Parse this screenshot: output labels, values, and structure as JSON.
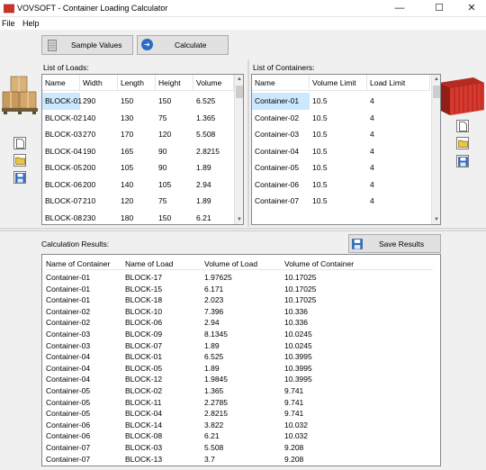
{
  "window": {
    "title": "VOVSOFT - Container Loading Calculator",
    "minimize_glyph": "—",
    "maximize_glyph": "☐",
    "close_glyph": "✕"
  },
  "menu": [
    "File",
    "Help"
  ],
  "toolbar": {
    "sample_values_label": "Sample Values",
    "calculate_label": "Calculate",
    "calculate_glyph": "➜"
  },
  "loads": {
    "label": "List of Loads:",
    "columns": [
      "Name",
      "Width",
      "Length",
      "Height",
      "Volume"
    ],
    "rows": [
      [
        "BLOCK-01",
        "290",
        "150",
        "150",
        "6.525"
      ],
      [
        "BLOCK-02",
        "140",
        "130",
        "75",
        "1.365"
      ],
      [
        "BLOCK-03",
        "270",
        "170",
        "120",
        "5.508"
      ],
      [
        "BLOCK-04",
        "190",
        "165",
        "90",
        "2.8215"
      ],
      [
        "BLOCK-05",
        "200",
        "105",
        "90",
        "1.89"
      ],
      [
        "BLOCK-06",
        "200",
        "140",
        "105",
        "2.94"
      ],
      [
        "BLOCK-07",
        "210",
        "120",
        "75",
        "1.89"
      ],
      [
        "BLOCK-08",
        "230",
        "180",
        "150",
        "6.21"
      ]
    ],
    "selected_row": 0
  },
  "containers": {
    "label": "List of Containers:",
    "columns": [
      "Name",
      "Volume Limit",
      "Load Limit"
    ],
    "rows": [
      [
        "Container-01",
        "10.5",
        "4"
      ],
      [
        "Container-02",
        "10.5",
        "4"
      ],
      [
        "Container-03",
        "10.5",
        "4"
      ],
      [
        "Container-04",
        "10.5",
        "4"
      ],
      [
        "Container-05",
        "10.5",
        "4"
      ],
      [
        "Container-06",
        "10.5",
        "4"
      ],
      [
        "Container-07",
        "10.5",
        "4"
      ]
    ],
    "selected_row": 0
  },
  "results": {
    "label": "Calculation Results:",
    "save_label": "Save Results",
    "columns": [
      "Name of Container",
      "Name of Load",
      "Volume of Load",
      "Volume of Container"
    ],
    "rows": [
      [
        "Container-01",
        "BLOCK-17",
        "1.97625",
        "10.17025"
      ],
      [
        "Container-01",
        "BLOCK-15",
        "6.171",
        "10.17025"
      ],
      [
        "Container-01",
        "BLOCK-18",
        "2.023",
        "10.17025"
      ],
      [
        "Container-02",
        "BLOCK-10",
        "7.396",
        "10.336"
      ],
      [
        "Container-02",
        "BLOCK-06",
        "2.94",
        "10.336"
      ],
      [
        "Container-03",
        "BLOCK-09",
        "8.1345",
        "10.0245"
      ],
      [
        "Container-03",
        "BLOCK-07",
        "1.89",
        "10.0245"
      ],
      [
        "Container-04",
        "BLOCK-01",
        "6.525",
        "10.3995"
      ],
      [
        "Container-04",
        "BLOCK-05",
        "1.89",
        "10.3995"
      ],
      [
        "Container-04",
        "BLOCK-12",
        "1.9845",
        "10.3995"
      ],
      [
        "Container-05",
        "BLOCK-02",
        "1.365",
        "9.741"
      ],
      [
        "Container-05",
        "BLOCK-11",
        "2.2785",
        "9.741"
      ],
      [
        "Container-05",
        "BLOCK-04",
        "2.8215",
        "9.741"
      ],
      [
        "Container-06",
        "BLOCK-14",
        "3.822",
        "10.032"
      ],
      [
        "Container-06",
        "BLOCK-08",
        "6.21",
        "10.032"
      ],
      [
        "Container-07",
        "BLOCK-03",
        "5.508",
        "9.208"
      ],
      [
        "Container-07",
        "BLOCK-13",
        "3.7",
        "9.208"
      ]
    ]
  },
  "icons": {
    "app": "container-app-icon",
    "new": "new-file-icon",
    "open": "open-folder-icon",
    "save": "save-disk-icon",
    "boxes": "pallet-boxes-icon",
    "container": "shipping-container-icon"
  },
  "colors": {
    "selection": "#cce8ff",
    "container_red": "#d9382e",
    "box_brown": "#c99a5b",
    "save_blue": "#2b6cc4"
  }
}
